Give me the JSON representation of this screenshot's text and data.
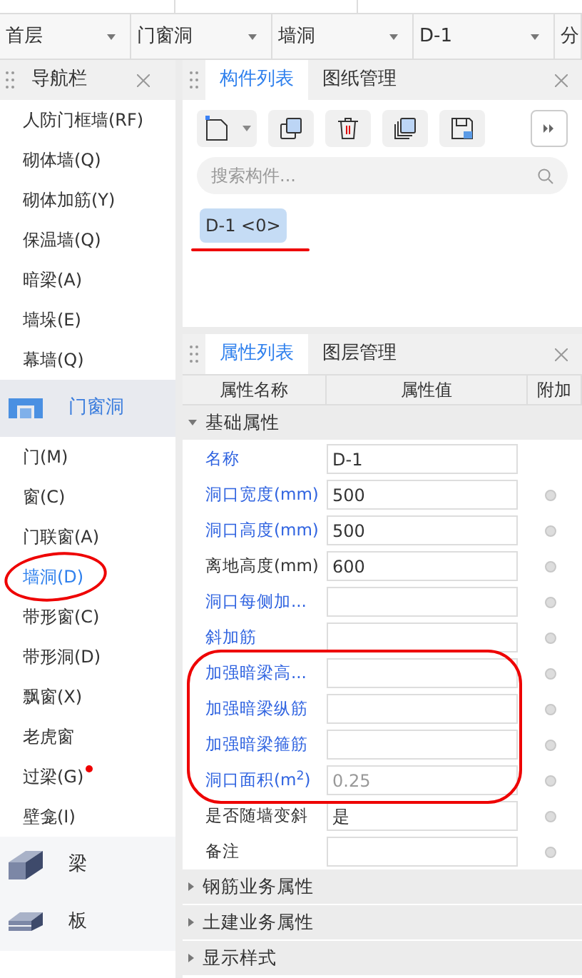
{
  "selectors": [
    {
      "value": "首层"
    },
    {
      "value": "门窗洞"
    },
    {
      "value": "墙洞"
    },
    {
      "value": "D-1"
    },
    {
      "value": "分"
    }
  ],
  "nav": {
    "title": "导航栏",
    "items": [
      {
        "kind": "item",
        "label": "人防门框墙(RF)",
        "selected": false
      },
      {
        "kind": "item",
        "label": "砌体墙(Q)",
        "selected": false
      },
      {
        "kind": "item",
        "label": "砌体加筋(Y)",
        "selected": false
      },
      {
        "kind": "item",
        "label": "保温墙(Q)",
        "selected": false
      },
      {
        "kind": "item",
        "label": "暗梁(A)",
        "selected": false
      },
      {
        "kind": "item",
        "label": "墙垛(E)",
        "selected": false
      },
      {
        "kind": "item",
        "label": "幕墙(Q)",
        "selected": false
      },
      {
        "kind": "category",
        "label": "门窗洞",
        "selected": true
      },
      {
        "kind": "item",
        "label": "门(M)",
        "selected": false
      },
      {
        "kind": "item",
        "label": "窗(C)",
        "selected": false
      },
      {
        "kind": "item",
        "label": "门联窗(A)",
        "selected": false
      },
      {
        "kind": "item",
        "label": "墙洞(D)",
        "selected": true,
        "circled": true
      },
      {
        "kind": "item",
        "label": "带形窗(C)",
        "selected": false
      },
      {
        "kind": "item",
        "label": "带形洞(D)",
        "selected": false
      },
      {
        "kind": "item",
        "label": "飘窗(X)",
        "selected": false
      },
      {
        "kind": "item",
        "label": "老虎窗",
        "selected": false
      },
      {
        "kind": "item",
        "label": "过梁(G)",
        "selected": false,
        "dot": true
      },
      {
        "kind": "item",
        "label": "壁龛(I)",
        "selected": false
      },
      {
        "kind": "category",
        "label": "梁",
        "selected": false
      },
      {
        "kind": "category",
        "label": "板",
        "selected": false
      }
    ]
  },
  "component_panel": {
    "tabs": [
      {
        "label": "构件列表",
        "selected": true
      },
      {
        "label": "图纸管理",
        "selected": false
      }
    ],
    "search": {
      "placeholder": "搜索构件..."
    },
    "components": [
      {
        "label": "D-1 <0>",
        "selected": true,
        "underlined": true
      }
    ]
  },
  "property_panel": {
    "tabs": [
      {
        "label": "属性列表",
        "selected": true
      },
      {
        "label": "图层管理",
        "selected": false
      }
    ],
    "columns": [
      "属性名称",
      "属性值",
      "附加"
    ],
    "groups": [
      {
        "label": "基础属性",
        "expanded": true,
        "rows": [
          {
            "name": "名称",
            "value": "D-1",
            "link": true,
            "attach": false,
            "readonly": false,
            "circled": false
          },
          {
            "name": "洞口宽度(mm)",
            "value": "500",
            "link": true,
            "attach": true,
            "readonly": false,
            "circled": false
          },
          {
            "name": "洞口高度(mm)",
            "value": "500",
            "link": true,
            "attach": true,
            "readonly": false,
            "circled": false
          },
          {
            "name": "离地高度(mm)",
            "value": "600",
            "link": false,
            "attach": true,
            "readonly": false,
            "circled": false
          },
          {
            "name": "洞口每侧加...",
            "value": "",
            "link": true,
            "attach": true,
            "readonly": false,
            "circled": false
          },
          {
            "name": "斜加筋",
            "value": "",
            "link": true,
            "attach": true,
            "readonly": false,
            "circled": false
          },
          {
            "name": "加强暗梁高...",
            "value": "",
            "link": true,
            "attach": true,
            "readonly": false,
            "circled": true
          },
          {
            "name": "加强暗梁纵筋",
            "value": "",
            "link": true,
            "attach": true,
            "readonly": false,
            "circled": true
          },
          {
            "name": "加强暗梁箍筋",
            "value": "",
            "link": true,
            "attach": true,
            "readonly": false,
            "circled": true
          },
          {
            "name": "洞口面积(m$^{2}$)",
            "value": "0.25",
            "link": true,
            "attach": true,
            "readonly": true,
            "circled": true
          },
          {
            "name": "是否随墙变斜",
            "value": "是",
            "link": false,
            "attach": true,
            "readonly": false,
            "circled": false
          },
          {
            "name": "备注",
            "value": "",
            "link": false,
            "attach": true,
            "readonly": false,
            "circled": false
          }
        ]
      },
      {
        "label": "钢筋业务属性",
        "expanded": false
      },
      {
        "label": "土建业务属性",
        "expanded": false
      },
      {
        "label": "显示样式",
        "expanded": false
      }
    ]
  }
}
